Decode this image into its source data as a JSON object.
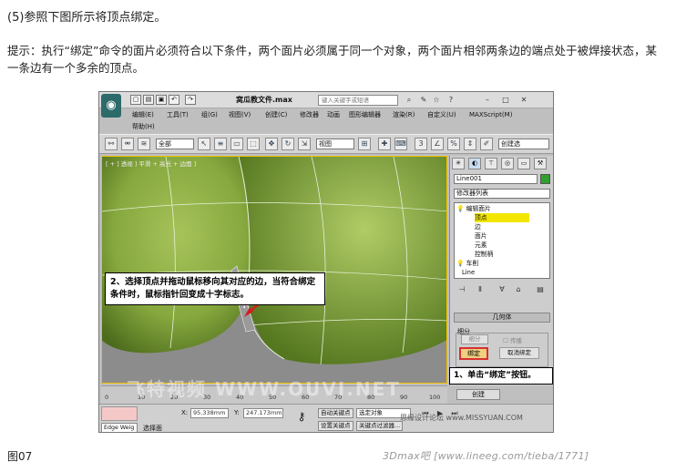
{
  "document": {
    "step_title": "(5)参照下图所示将顶点绑定。",
    "hint": "提示：执行“绑定”命令的面片必须符合以下条件，两个面片必须属于同一个对象，两个面片相邻两条边的端点处于被焊接状态，某一条边有一个多余的顶点。",
    "figure_label": "图07",
    "footer_watermark": "3Dmax吧 [www.lineeg.com/tieba/1771]"
  },
  "screenshot": {
    "window_title": "窝瓜教文件.max",
    "search_placeholder": "键入关键字或短语",
    "menu": [
      "编辑(E)",
      "工具(T)",
      "组(G)",
      "视图(V)",
      "创建(C)",
      "修改器",
      "动画",
      "图形编辑器",
      "渲染(R)",
      "自定义(U)",
      "MAXScript(M)"
    ],
    "help_menu": "帮助(H)",
    "toolbar": {
      "filter_select": "全部",
      "view_select": "视图",
      "create_selection_set": "创建选"
    },
    "viewport_label": "[ + ] 透视 ] 平滑 + 高光 + 边面 ]",
    "callout_left": "2、选择顶点并拖动鼠标移向其对应的边，当符合绑定条件时，鼠标指针回变成十字标志。",
    "callout_right": "1、单击“绑定”按钮。",
    "panel": {
      "object_name": "Line001",
      "modifier_list": "修改器列表",
      "stack": [
        "编辑面片",
        "顶点",
        "边",
        "面片",
        "元素",
        "控制柄",
        "车削",
        "Line"
      ],
      "rollout_title": "几何体",
      "group_label": "细分",
      "subdivide_button": "细分",
      "propagate_checkbox": "传播",
      "bind_button": "绑定",
      "unbind_button": "取消绑定"
    },
    "timeline_ticks": [
      "0",
      "10",
      "20",
      "30",
      "40",
      "50",
      "60",
      "70",
      "80",
      "90",
      "100"
    ],
    "status": {
      "edge_field": "Edge Weig",
      "status_text": "选择面",
      "x_label": "X:",
      "x_value": "95.338mm",
      "y_label": "Y:",
      "y_value": "247.173mm",
      "auto_key": "自动关键点",
      "selected_object": "选定对象",
      "set_key": "设置关键点",
      "key_filters": "关键点过滤器...",
      "create_button": "创建"
    },
    "watermarks": [
      "思缘设计论坛 www.MISSYUAN.COM",
      "飞特视频 WWW.OUVI.NET"
    ]
  }
}
